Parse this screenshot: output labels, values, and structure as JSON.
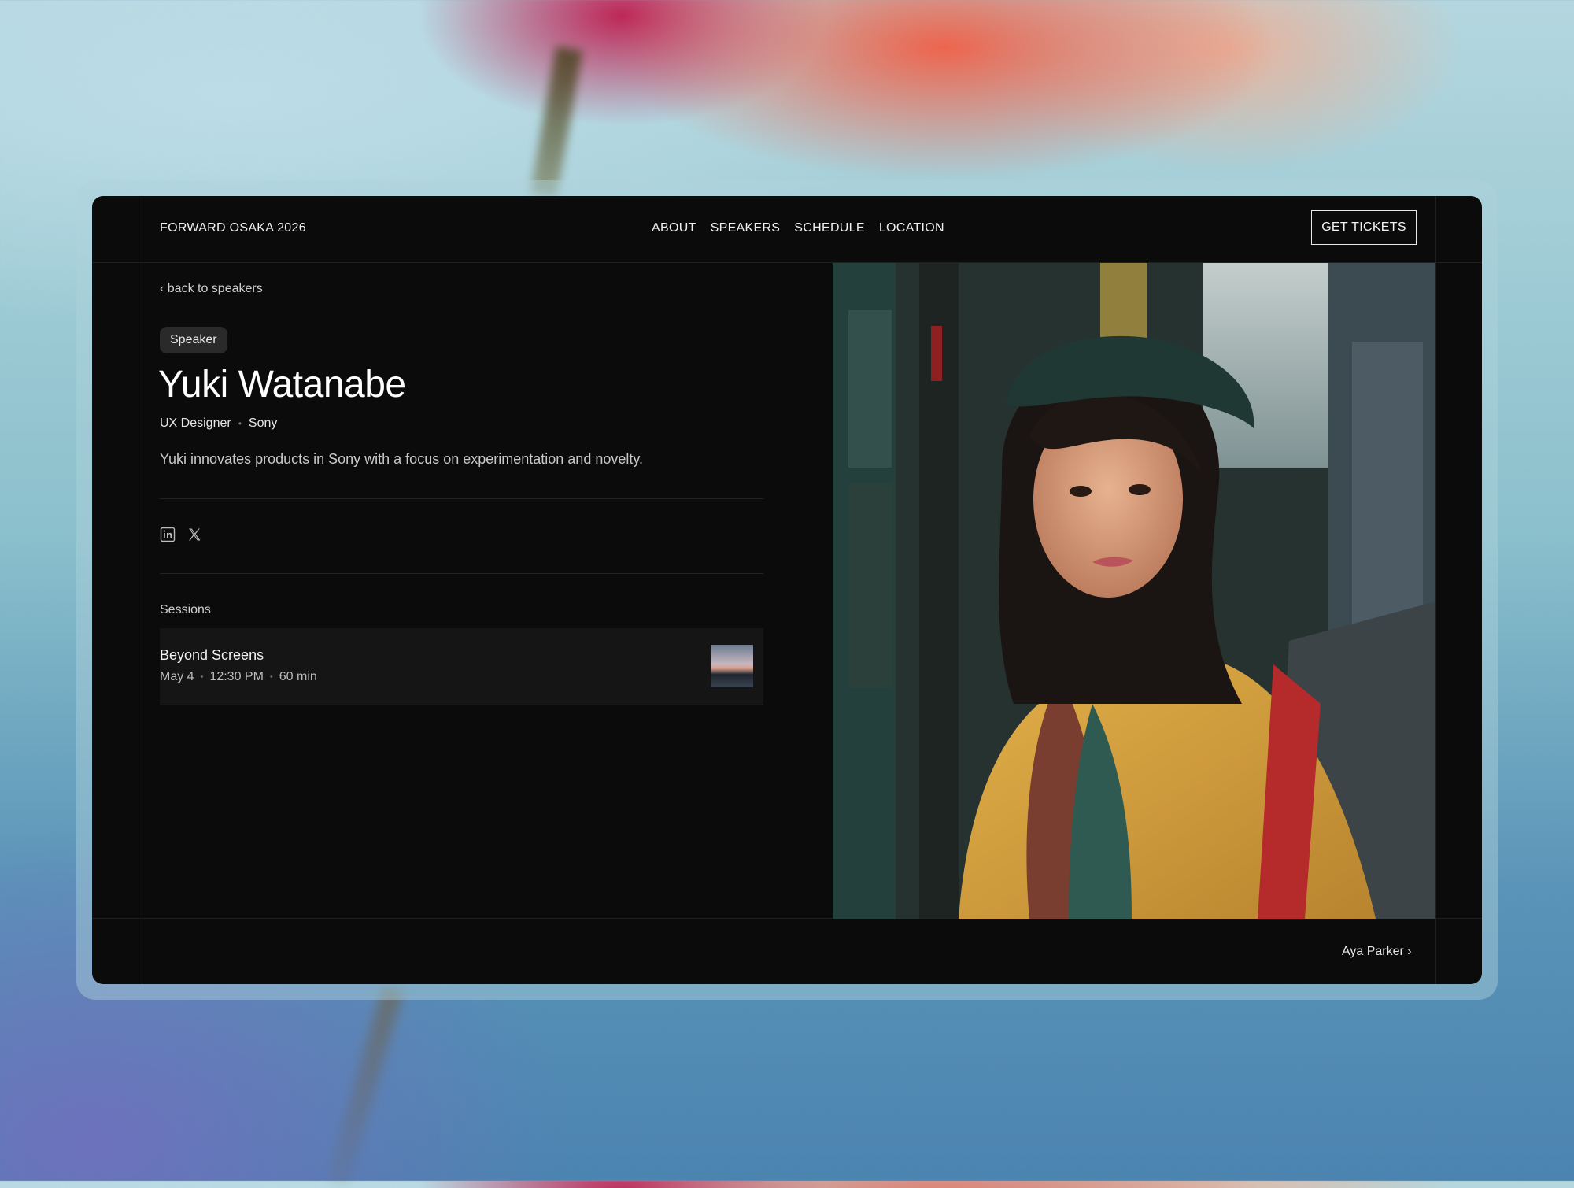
{
  "header": {
    "brand": "FORWARD OSAKA 2026",
    "nav": [
      "ABOUT",
      "SPEAKERS",
      "SCHEDULE",
      "LOCATION"
    ],
    "cta": "GET TICKETS"
  },
  "speaker": {
    "back_link": "‹ back to speakers",
    "badge": "Speaker",
    "name": "Yuki Watanabe",
    "role": "UX Designer",
    "company": "Sony",
    "bio": "Yuki innovates products in Sony with a focus on experimentation and novelty.",
    "social_icons": [
      "linkedin-icon",
      "x-icon"
    ],
    "photo_icon": "speaker-portrait"
  },
  "sessions": {
    "label": "Sessions",
    "items": [
      {
        "title": "Beyond Screens",
        "date": "May 4",
        "time": "12:30 PM",
        "duration": "60 min"
      }
    ]
  },
  "footer": {
    "next_speaker": "Aya Parker ›"
  },
  "colors": {
    "page_bg": "#0b0b0b",
    "text": "#f2f2f2",
    "muted": "#bdbdbd",
    "badge_bg": "#2a2a2a",
    "card_bg": "#151515"
  }
}
